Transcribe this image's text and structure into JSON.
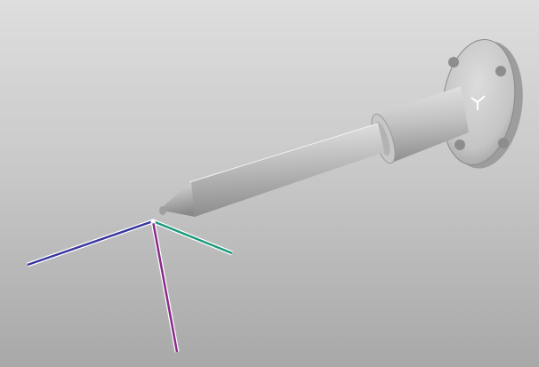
{
  "viewport": {
    "background_top": "#dedede",
    "background_bottom": "#a8a8a8"
  },
  "model": {
    "part_color": "#bdbdbd",
    "highlight_color": "#e6e6e6",
    "shadow_color": "#7a7a7a",
    "flange_hole_count": 4,
    "icon": "shaft-with-flange-icon"
  },
  "triad": {
    "icon": "coordinate-triad-icon",
    "x_axis_color": "#3a36a0",
    "y_axis_color": "#1c9a7c",
    "z_axis_color": "#8a2a8a"
  },
  "flange_marker": {
    "icon": "y-marker-icon",
    "color": "#ffffff"
  }
}
